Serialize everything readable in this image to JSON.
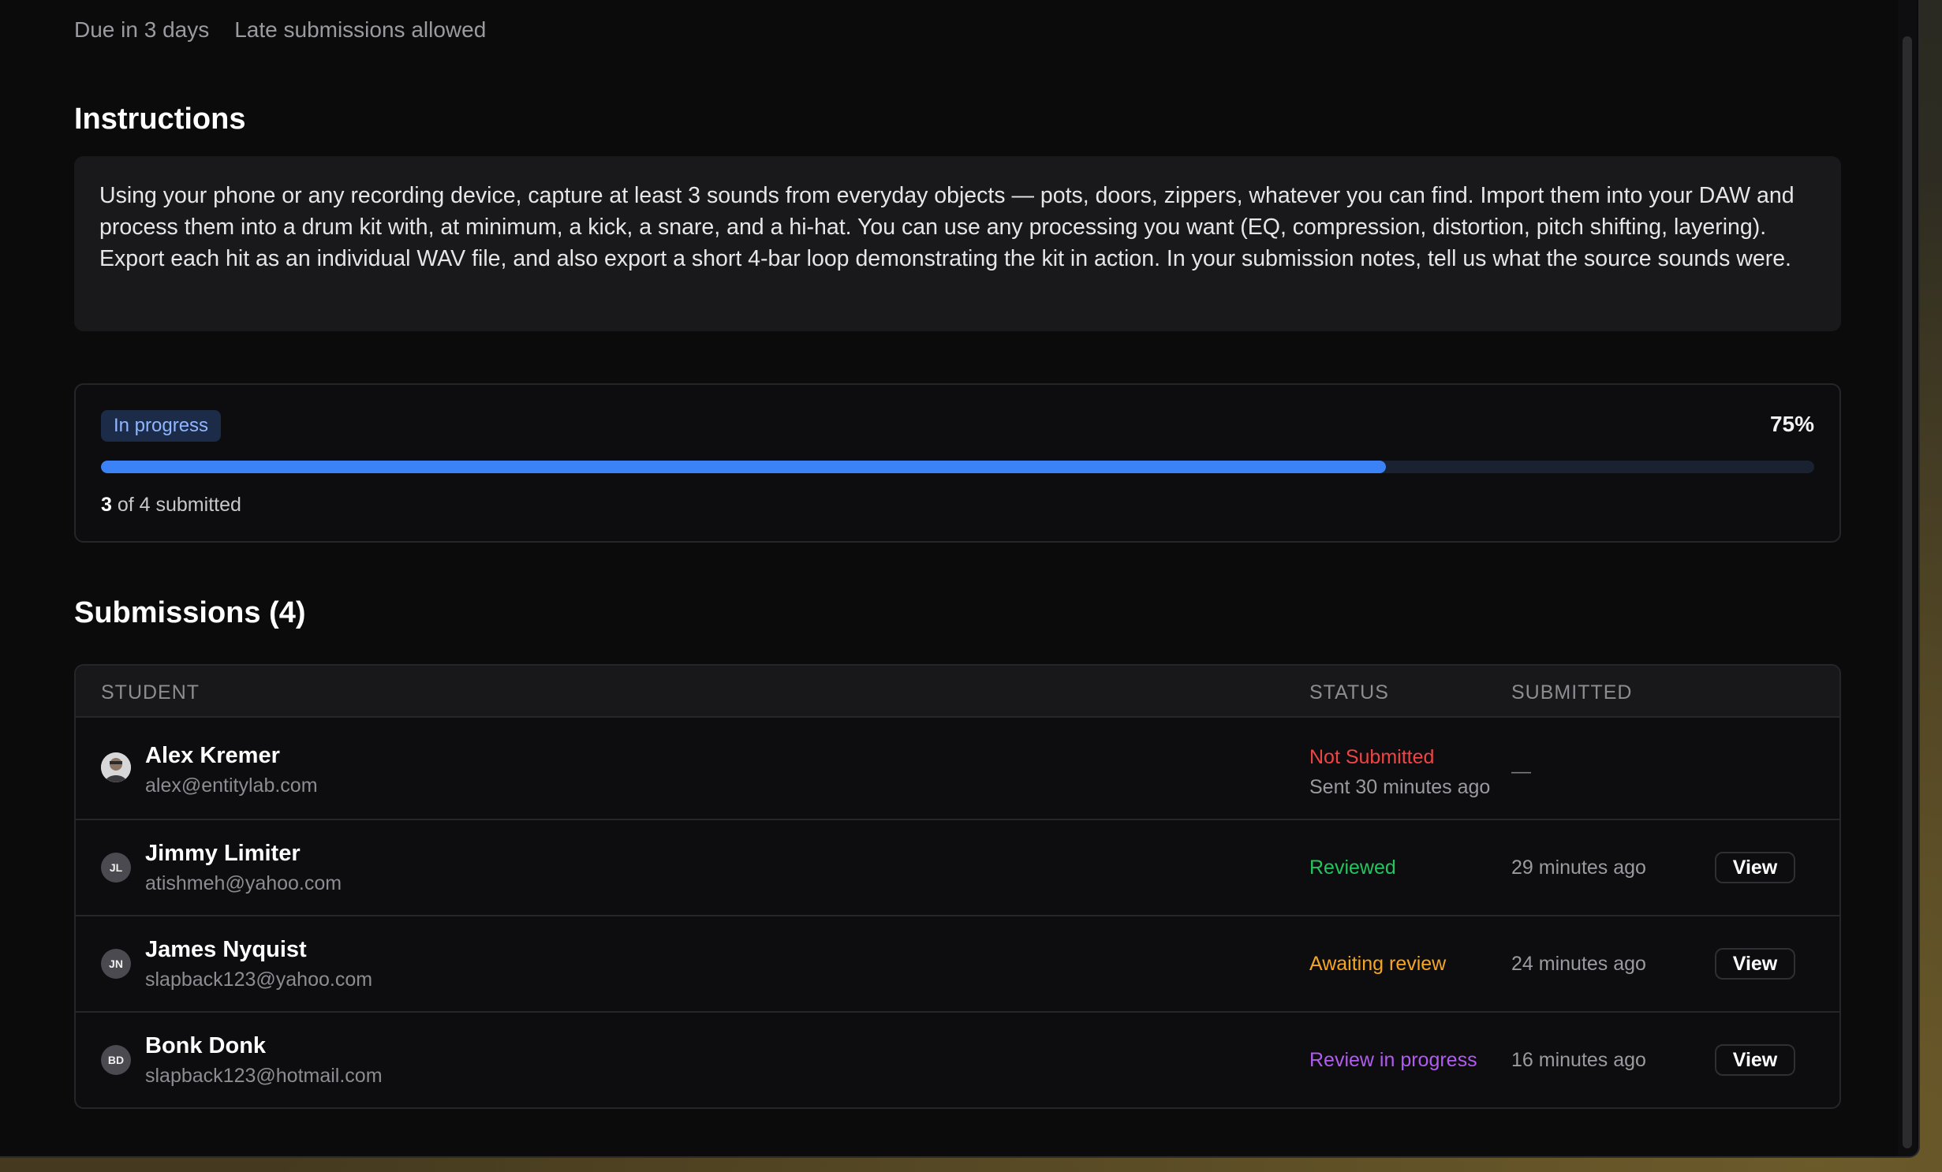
{
  "assignment": {
    "due": "Due in 3 days",
    "late_policy": "Late submissions allowed"
  },
  "instructions": {
    "title": "Instructions",
    "body": "Using your phone or any recording device, capture at least 3 sounds from everyday objects — pots, doors, zippers, whatever you can find. Import them into your DAW and process them into a drum kit with, at minimum, a kick, a snare, and a hi-hat. You can use any processing you want (EQ, compression, distortion, pitch shifting, layering). Export each hit as an individual WAV file, and also export a short 4-bar loop demonstrating the kit in action. In your submission notes, tell us what the source sounds were."
  },
  "progress": {
    "status_label": "In progress",
    "percent_label": "75%",
    "fraction": 0.75,
    "submitted_count": "3",
    "summary_rest": "of 4 submitted"
  },
  "submissions": {
    "title": "Submissions (4)",
    "columns": {
      "student": "STUDENT",
      "status": "STATUS",
      "submitted": "SUBMITTED"
    },
    "rows": [
      {
        "name": "Alex Kremer",
        "email": "alex@entitylab.com",
        "avatar": "",
        "status": "Not Submitted",
        "status_color": "#f04444",
        "status_sub": "Sent 30 minutes ago",
        "submitted": "—",
        "action": ""
      },
      {
        "name": "Jimmy Limiter",
        "email": "atishmeh@yahoo.com",
        "avatar": "JL",
        "status": "Reviewed",
        "status_color": "#22c55e",
        "submitted": "29 minutes ago",
        "action": "View"
      },
      {
        "name": "James Nyquist",
        "email": "slapback123@yahoo.com",
        "avatar": "JN",
        "status": "Awaiting review",
        "status_color": "#f5a524",
        "submitted": "24 minutes ago",
        "action": "View"
      },
      {
        "name": "Bonk Donk",
        "email": "slapback123@hotmail.com",
        "avatar": "BD",
        "status": "Review in progress",
        "status_color": "#b25bf0",
        "submitted": "16 minutes ago",
        "action": "View"
      }
    ]
  },
  "colors": {
    "accent": "#3b82f6",
    "background": "#0b0b0c",
    "card": "#19191b"
  }
}
